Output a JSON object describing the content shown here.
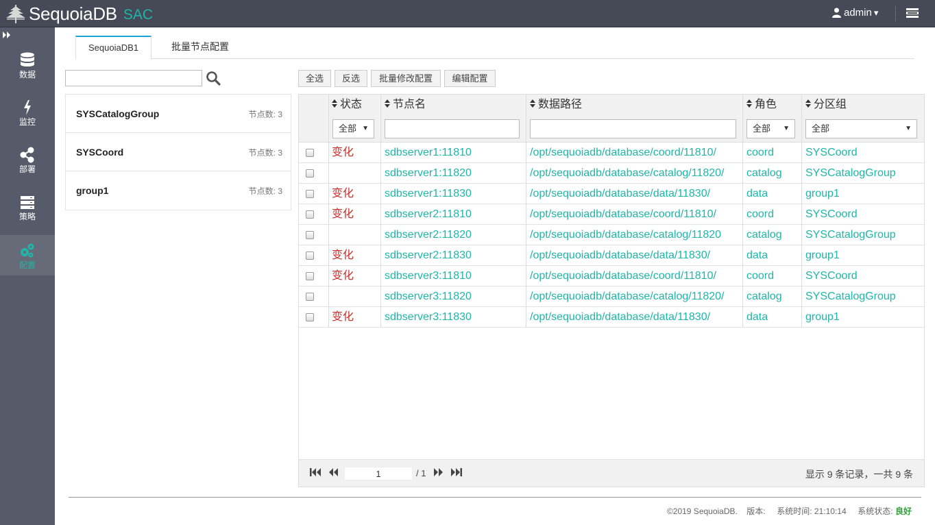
{
  "header": {
    "brand": "SequoiaDB",
    "product": "SAC",
    "user": "admin",
    "user_caret": "▾"
  },
  "sidebar": {
    "collapse_icon": "double-chevron-right-icon",
    "items": [
      {
        "label": "数据",
        "icon": "database-icon"
      },
      {
        "label": "监控",
        "icon": "lightning-icon"
      },
      {
        "label": "部署",
        "icon": "share-icon"
      },
      {
        "label": "策略",
        "icon": "server-icon"
      },
      {
        "label": "配置",
        "icon": "gears-icon",
        "active": true
      }
    ]
  },
  "tabs": [
    {
      "label": "SequoiaDB1",
      "active": true
    },
    {
      "label": "批量节点配置",
      "active": false
    }
  ],
  "search": {
    "value": "",
    "placeholder": ""
  },
  "groups": [
    {
      "name": "SYSCatalogGroup",
      "count": "节点数: 3"
    },
    {
      "name": "SYSCoord",
      "count": "节点数: 3"
    },
    {
      "name": "group1",
      "count": "节点数: 3"
    }
  ],
  "toolbar": {
    "select_all": "全选",
    "invert": "反选",
    "batch_modify": "批量修改配置",
    "edit_config": "编辑配置"
  },
  "table": {
    "columns": [
      "状态",
      "节点名",
      "数据路径",
      "角色",
      "分区组"
    ],
    "filters": {
      "status": "全部",
      "role": "全部",
      "group": "全部",
      "node": "",
      "path": ""
    },
    "rows": [
      {
        "status": "变化",
        "node": "sdbserver1:11810",
        "path": "/opt/sequoiadb/database/coord/11810/",
        "role": "coord",
        "group": "SYSCoord"
      },
      {
        "status": "",
        "node": "sdbserver1:11820",
        "path": "/opt/sequoiadb/database/catalog/11820/",
        "role": "catalog",
        "group": "SYSCatalogGroup"
      },
      {
        "status": "变化",
        "node": "sdbserver1:11830",
        "path": "/opt/sequoiadb/database/data/11830/",
        "role": "data",
        "group": "group1"
      },
      {
        "status": "变化",
        "node": "sdbserver2:11810",
        "path": "/opt/sequoiadb/database/coord/11810/",
        "role": "coord",
        "group": "SYSCoord"
      },
      {
        "status": "",
        "node": "sdbserver2:11820",
        "path": "/opt/sequoiadb/database/catalog/11820",
        "role": "catalog",
        "group": "SYSCatalogGroup"
      },
      {
        "status": "变化",
        "node": "sdbserver2:11830",
        "path": "/opt/sequoiadb/database/data/11830/",
        "role": "data",
        "group": "group1"
      },
      {
        "status": "变化",
        "node": "sdbserver3:11810",
        "path": "/opt/sequoiadb/database/coord/11810/",
        "role": "coord",
        "group": "SYSCoord"
      },
      {
        "status": "",
        "node": "sdbserver3:11820",
        "path": "/opt/sequoiadb/database/catalog/11820/",
        "role": "catalog",
        "group": "SYSCatalogGroup"
      },
      {
        "status": "变化",
        "node": "sdbserver3:11830",
        "path": "/opt/sequoiadb/database/data/11830/",
        "role": "data",
        "group": "group1"
      }
    ]
  },
  "pagination": {
    "page": "1",
    "total": "/ 1",
    "record_info": "显示 9 条记录，一共 9 条"
  },
  "footer": {
    "copyright": "©2019 SequoiaDB.",
    "version_label": "版本:",
    "time_label": "系统时间:",
    "time": "21:10:14",
    "status_label": "系统状态:",
    "status": "良好"
  },
  "colors": {
    "topbar": "#454a56",
    "sidebar": "#565a69",
    "accent": "#1fb5a8",
    "status_changed": "#c9302c",
    "status_good": "#2e9e3a"
  }
}
